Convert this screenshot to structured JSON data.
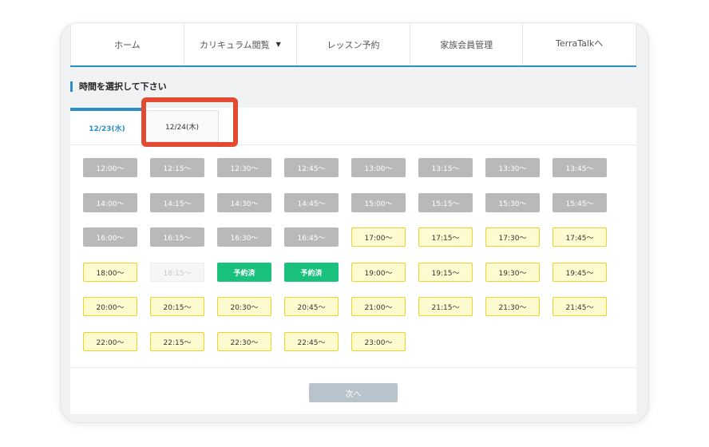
{
  "nav": {
    "items": [
      {
        "label": "ホーム"
      },
      {
        "label": "カリキュラム閲覧"
      },
      {
        "label": "レッスン予約"
      },
      {
        "label": "家族会員管理"
      },
      {
        "label": "TerraTalkへ"
      }
    ]
  },
  "section_title": "時間を選択して下さい",
  "tabs": [
    {
      "label": "12/23(水)",
      "active": true
    },
    {
      "label": "12/24(木)",
      "active": false
    }
  ],
  "slots": [
    {
      "time": "12:00～",
      "status": "past"
    },
    {
      "time": "12:15～",
      "status": "past"
    },
    {
      "time": "12:30～",
      "status": "past"
    },
    {
      "time": "12:45～",
      "status": "past"
    },
    {
      "time": "13:00～",
      "status": "past"
    },
    {
      "time": "13:15～",
      "status": "past"
    },
    {
      "time": "13:30～",
      "status": "past"
    },
    {
      "time": "13:45～",
      "status": "past"
    },
    {
      "time": "14:00～",
      "status": "past"
    },
    {
      "time": "14:15～",
      "status": "past"
    },
    {
      "time": "14:30～",
      "status": "past"
    },
    {
      "time": "14:45～",
      "status": "past"
    },
    {
      "time": "15:00～",
      "status": "past"
    },
    {
      "time": "15:15～",
      "status": "past"
    },
    {
      "time": "15:30～",
      "status": "past"
    },
    {
      "time": "15:45～",
      "status": "past"
    },
    {
      "time": "16:00～",
      "status": "past"
    },
    {
      "time": "16:15～",
      "status": "past"
    },
    {
      "time": "16:30～",
      "status": "past"
    },
    {
      "time": "16:45～",
      "status": "past"
    },
    {
      "time": "17:00～",
      "status": "available"
    },
    {
      "time": "17:15～",
      "status": "available"
    },
    {
      "time": "17:30～",
      "status": "available"
    },
    {
      "time": "17:45～",
      "status": "available"
    },
    {
      "time": "18:00～",
      "status": "available"
    },
    {
      "time": "18:15～",
      "status": "disabled"
    },
    {
      "time": "予約済",
      "status": "booked"
    },
    {
      "time": "予約済",
      "status": "booked"
    },
    {
      "time": "19:00～",
      "status": "available"
    },
    {
      "time": "19:15～",
      "status": "available"
    },
    {
      "time": "19:30～",
      "status": "available"
    },
    {
      "time": "19:45～",
      "status": "available"
    },
    {
      "time": "20:00～",
      "status": "available"
    },
    {
      "time": "20:15～",
      "status": "available"
    },
    {
      "time": "20:30～",
      "status": "available"
    },
    {
      "time": "20:45～",
      "status": "available"
    },
    {
      "time": "21:00～",
      "status": "available"
    },
    {
      "time": "21:15～",
      "status": "available"
    },
    {
      "time": "21:30～",
      "status": "available"
    },
    {
      "time": "21:45～",
      "status": "available"
    },
    {
      "time": "22:00～",
      "status": "available"
    },
    {
      "time": "22:15～",
      "status": "available"
    },
    {
      "time": "22:30～",
      "status": "available"
    },
    {
      "time": "22:45～",
      "status": "available"
    },
    {
      "time": "23:00～",
      "status": "available"
    }
  ],
  "next_button": "次へ",
  "colors": {
    "accent": "#2a8fc4",
    "highlight": "#e24a32",
    "past": "#b9b9b9",
    "available_bg": "#fffbd1",
    "available_border": "#ecd22a",
    "booked": "#19c17d",
    "next_button": "#b7c4cb"
  }
}
